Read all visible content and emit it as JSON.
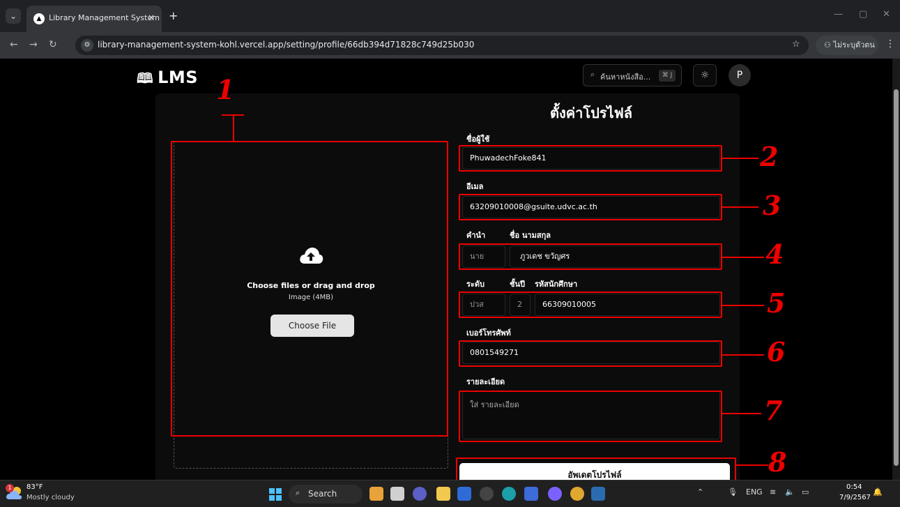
{
  "browser": {
    "tab_title": "Library Management System",
    "tab_close": "×",
    "new_tab": "+",
    "url": "library-management-system-kohl.vercel.app/setting/profile/66db394d71828c749d25b030",
    "profile_label": "ไม่ระบุตัวตน"
  },
  "header": {
    "logo": "LMS",
    "search_placeholder": "ค้นหาหนังสือ...",
    "search_shortcut": "⌘ J",
    "avatar_initial": "P"
  },
  "form": {
    "title": "ตั้งค่าโปรไฟล์",
    "upload": {
      "main_text": "Choose files or drag and drop",
      "sub_text": "Image (4MB)",
      "button": "Choose File"
    },
    "username": {
      "label": "ชื่อผู้ใช้",
      "value": "PhuwadechFoke841"
    },
    "email": {
      "label": "อีเมล",
      "value": "63209010008@gsuite.udvc.ac.th"
    },
    "prefix": {
      "label": "คำนำ",
      "value": "นาย"
    },
    "fullname": {
      "label": "ชื่อ นามสกุล",
      "value": "ภูวเดช ขวัญศร"
    },
    "level": {
      "label": "ระดับ",
      "value": "ปวส"
    },
    "year": {
      "label": "ชั้นปี",
      "value": "2"
    },
    "student_id": {
      "label": "รหัสนักศึกษา",
      "value": "66309010005"
    },
    "phone": {
      "label": "เบอร์โทรศัพท์",
      "value": "0801549271"
    },
    "details": {
      "label": "รายละเอียด",
      "placeholder": "ใส่ รายละเอียด"
    },
    "submit": "อัพเดตโปรไฟล์"
  },
  "annotations": [
    "1",
    "2",
    "3",
    "4",
    "5",
    "6",
    "7",
    "8"
  ],
  "taskbar": {
    "weather_temp": "83°F",
    "weather_desc": "Mostly cloudy",
    "weather_badge": "1",
    "search_label": "Search",
    "lang": "ENG",
    "time": "0:54",
    "date": "7/9/2567"
  },
  "colors": {
    "annotation": "#e00000",
    "accent": "#4cc2ff"
  }
}
